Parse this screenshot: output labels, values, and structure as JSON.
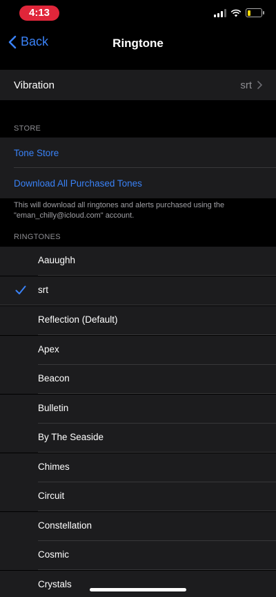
{
  "status_bar": {
    "time": "4:13",
    "time_pill_color": "#e0263a",
    "battery_color": "#f5d90a"
  },
  "nav": {
    "back_label": "Back",
    "title": "Ringtone"
  },
  "vibration": {
    "label": "Vibration",
    "value": "srt"
  },
  "store": {
    "header": "STORE",
    "tone_store_label": "Tone Store",
    "download_label": "Download All Purchased Tones",
    "note": "This will download all ringtones and alerts purchased using the \"eman_chilly@icloud.com\" account."
  },
  "ringtones": {
    "header": "RINGTONES",
    "items": [
      {
        "name": "Aauughh",
        "selected": false
      },
      {
        "name": "srt",
        "selected": true
      },
      {
        "name": "Reflection (Default)",
        "selected": false
      },
      {
        "name": "Apex",
        "selected": false
      },
      {
        "name": "Beacon",
        "selected": false
      },
      {
        "name": "Bulletin",
        "selected": false
      },
      {
        "name": "By The Seaside",
        "selected": false
      },
      {
        "name": "Chimes",
        "selected": false
      },
      {
        "name": "Circuit",
        "selected": false
      },
      {
        "name": "Constellation",
        "selected": false
      },
      {
        "name": "Cosmic",
        "selected": false
      },
      {
        "name": "Crystals",
        "selected": false
      }
    ]
  },
  "accent_color": "#3a82f7"
}
